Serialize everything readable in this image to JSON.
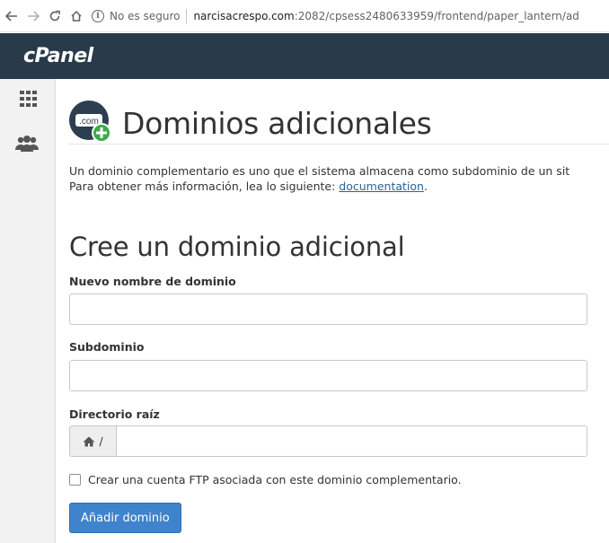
{
  "browser": {
    "security_label": "No es seguro",
    "url_host": "narcisacrespo.com",
    "url_rest": ":2082/cpsess2480633959/frontend/paper_lantern/ad"
  },
  "header": {
    "logo_text": "cPanel"
  },
  "sidebar": {
    "items": [
      {
        "icon": "grid-icon"
      },
      {
        "icon": "users-icon"
      }
    ]
  },
  "page": {
    "title": "Dominios adicionales",
    "title_icon_text": ".com",
    "description_line1": "Un dominio complementario es uno que el sistema almacena como subdominio de un sit",
    "description_line2_prefix": "Para obtener más información, lea lo siguiente: ",
    "description_link": "documentation",
    "description_line2_suffix": "."
  },
  "form": {
    "section_title": "Cree un dominio adicional",
    "new_domain_label": "Nuevo nombre de dominio",
    "new_domain_value": "",
    "subdomain_label": "Subdominio",
    "subdomain_value": "",
    "docroot_label": "Directorio raíz",
    "docroot_prefix": "/",
    "docroot_value": "",
    "ftp_checkbox_label": "Crear una cuenta FTP asociada con este dominio complementario.",
    "ftp_checked": false,
    "submit_label": "Añadir dominio"
  },
  "colors": {
    "header_bg": "#293a4a",
    "primary_button": "#3f83cc",
    "link": "#2a6496"
  }
}
